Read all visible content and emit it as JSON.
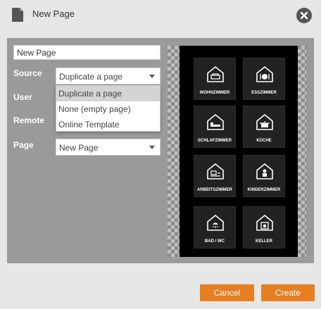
{
  "dialog": {
    "title": "New Page"
  },
  "form": {
    "name_value": "New Page",
    "source_label": "Source",
    "source_value": "Duplicate a page",
    "user_label": "User",
    "remote_label": "Remote",
    "page_label": "Page",
    "page_value": "New Page"
  },
  "dropdown": {
    "options": [
      "Duplicate a page",
      "None (empty page)",
      "Online Template"
    ],
    "selected": "Duplicate a page"
  },
  "preview": {
    "tiles": [
      {
        "label": "WOHNZIMMER",
        "icon": "sofa-icon"
      },
      {
        "label": "ESSZIMMER",
        "icon": "dining-icon"
      },
      {
        "label": "SCHLAFZIMMER",
        "icon": "bed-icon"
      },
      {
        "label": "KÜCHE",
        "icon": "pot-icon"
      },
      {
        "label": "ARBEITSZIMMER",
        "icon": "desk-icon"
      },
      {
        "label": "KINDERZIMMER",
        "icon": "child-icon"
      },
      {
        "label": "BAD / WC",
        "icon": "shower-icon"
      },
      {
        "label": "KELLER",
        "icon": "washer-icon"
      }
    ]
  },
  "actions": {
    "cancel": "Cancel",
    "create": "Create"
  },
  "colors": {
    "accent": "#e67e22",
    "panel": "#9a9a9a",
    "background": "#e6e6e6"
  }
}
